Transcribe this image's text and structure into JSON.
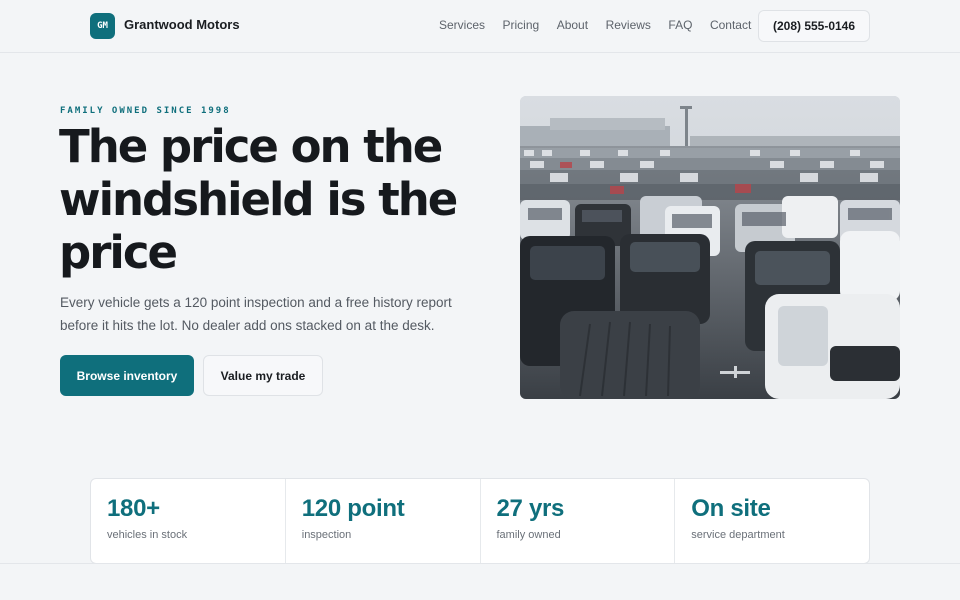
{
  "header": {
    "logo_text": "GM",
    "brand": "Grantwood Motors",
    "nav": [
      "Services",
      "Pricing",
      "About",
      "Reviews",
      "FAQ",
      "Contact"
    ],
    "phone": "(208) 555-0146"
  },
  "hero": {
    "eyebrow": "FAMILY OWNED SINCE 1998",
    "headline": "The price on the windshield is the price",
    "subtext": "Every vehicle gets a 120 point inspection and a free history report before it hits the lot. No dealer add ons stacked on at the desk.",
    "primary_cta": "Browse inventory",
    "secondary_cta": "Value my trade",
    "accent_color": "#0f6f7c"
  },
  "stats": [
    {
      "value": "180+",
      "label": "vehicles in stock"
    },
    {
      "value": "120 point",
      "label": "inspection"
    },
    {
      "value": "27 yrs",
      "label": "family owned"
    },
    {
      "value": "On site",
      "label": "service department"
    }
  ]
}
